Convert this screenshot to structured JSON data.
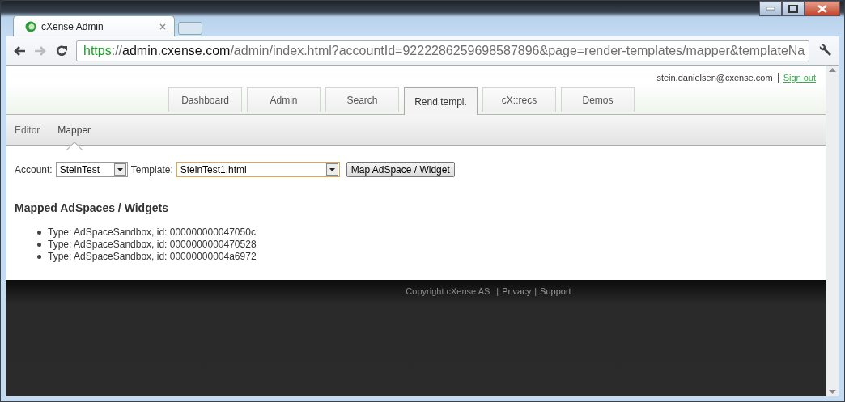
{
  "browser": {
    "tab_title": "cXense Admin",
    "url_parts": [
      {
        "text": "https",
        "kind": "scheme"
      },
      {
        "text": "://",
        "kind": "path"
      },
      {
        "text": "admin.cxense.com",
        "kind": "host"
      },
      {
        "text": "/admin/index.html?accountId=9222286259698587896&page=render-templates/mapper&templateNa",
        "kind": "path"
      }
    ]
  },
  "header": {
    "user": "stein.danielsen@cxense.com",
    "sign_out": "Sign out"
  },
  "tabs": [
    {
      "label": "Dashboard",
      "selected": false
    },
    {
      "label": "Admin",
      "selected": false
    },
    {
      "label": "Search",
      "selected": false
    },
    {
      "label": "Rend.templ.",
      "selected": true
    },
    {
      "label": "cX::recs",
      "selected": false
    },
    {
      "label": "Demos",
      "selected": false
    }
  ],
  "subtabs": [
    {
      "label": "Editor",
      "selected": false
    },
    {
      "label": "Mapper",
      "selected": true
    }
  ],
  "form": {
    "account_label": "Account:",
    "account_value": "SteinTest",
    "template_label": "Template:",
    "template_value": "SteinTest1.html",
    "template_focused": true,
    "button": "Map AdSpace / Widget"
  },
  "mapped": {
    "heading": "Mapped AdSpaces / Widgets",
    "items": [
      "Type: AdSpaceSandbox, id: 000000000047050c",
      "Type: AdSpaceSandbox, id: 0000000000470528",
      "Type: AdSpaceSandbox, id: 00000000004a6972"
    ]
  },
  "footer": [
    {
      "text": "Copyright cXense AS",
      "kind": "text"
    },
    {
      "text": "|",
      "kind": "separator"
    },
    {
      "text": "Privacy",
      "kind": "link"
    },
    {
      "text": "|",
      "kind": "separator"
    },
    {
      "text": "Support",
      "kind": "link"
    }
  ]
}
